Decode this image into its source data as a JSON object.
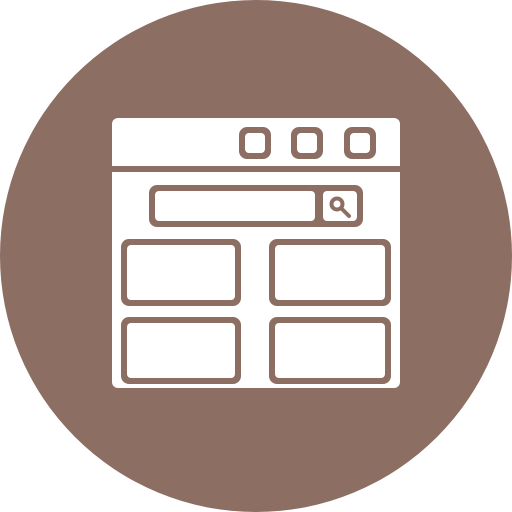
{
  "icon": {
    "name": "browser-window-search-icon",
    "colors": {
      "circle": "#8D6E63",
      "glyph": "#FFFFFF"
    },
    "window": {
      "control_buttons": [
        "control-button-1",
        "control-button-2",
        "control-button-3"
      ],
      "search": {
        "icon": "search-icon"
      },
      "content_cards": [
        "card-top-left",
        "card-top-right",
        "card-bottom-left",
        "card-bottom-right"
      ]
    }
  }
}
